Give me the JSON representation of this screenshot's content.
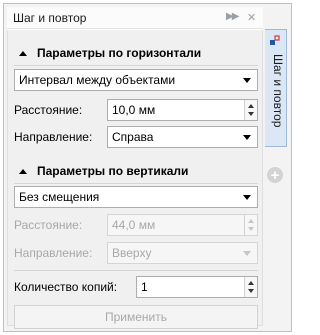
{
  "panel": {
    "title": "Шаг и повтор",
    "side_tab_label": "Шаг и повтор"
  },
  "horizontal": {
    "header": "Параметры по горизонтали",
    "mode": "Интервал между объектами",
    "distance_label": "Расстояние:",
    "distance_value": "10,0 мм",
    "direction_label": "Направление:",
    "direction_value": "Справа"
  },
  "vertical": {
    "header": "Параметры по вертикали",
    "mode": "Без смещения",
    "distance_label": "Расстояние:",
    "distance_value": "44,0 мм",
    "direction_label": "Направление:",
    "direction_value": "Вверху"
  },
  "copies": {
    "label": "Количество копий:",
    "value": "1"
  },
  "apply_label": "Применить",
  "icons": {
    "pin": "pin-icon",
    "collapse": "double-chevron-right-icon",
    "close": "close-icon",
    "add": "plus-icon"
  },
  "colors": {
    "side_tab_bg": "#dbe7f5",
    "disabled_text": "#a8a8a8"
  }
}
